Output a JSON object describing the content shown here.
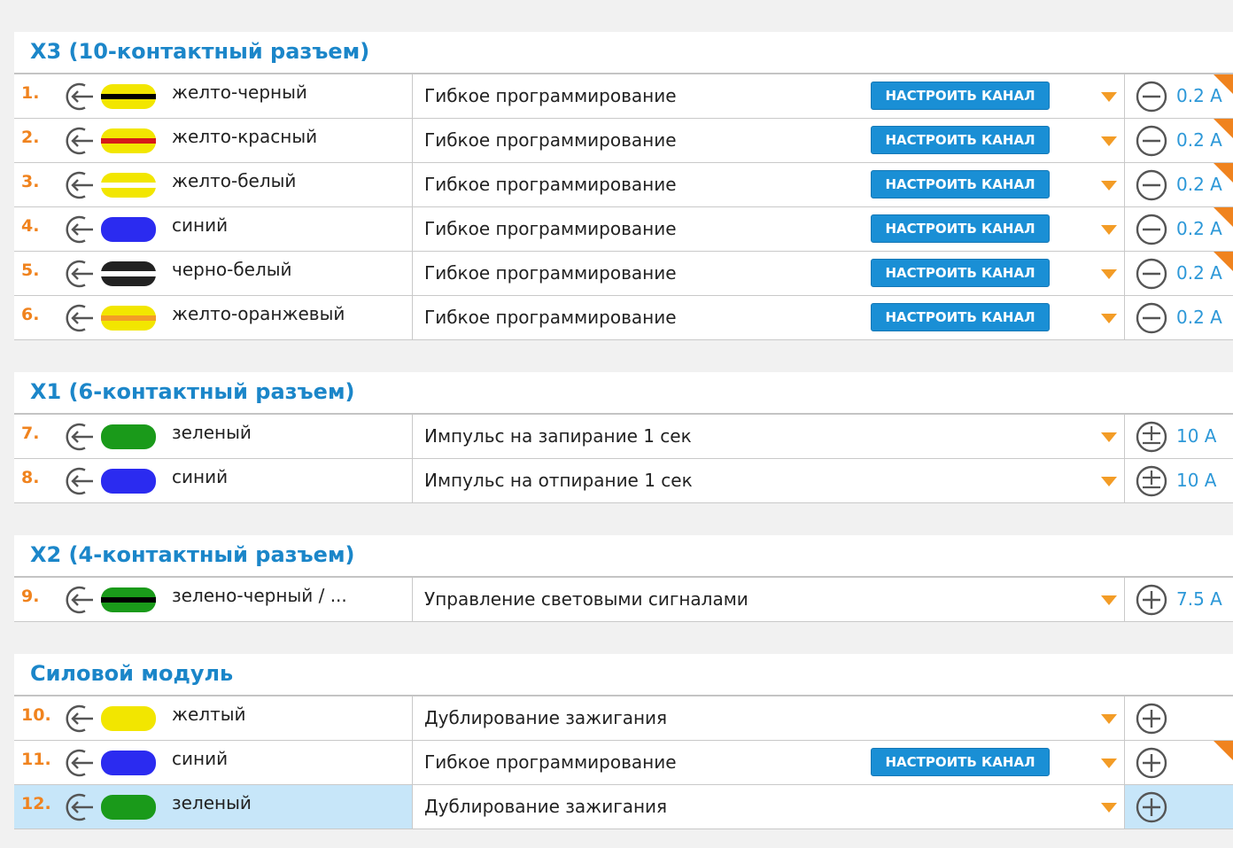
{
  "sections": [
    {
      "title": "X3 (10-контактный разъем)",
      "rows": [
        {
          "num": "1.",
          "wire_colors": [
            "#f2e600",
            "#000000"
          ],
          "color_name": "желто-черный",
          "function": "Гибкое программирование",
          "has_setup": true,
          "setup_label": "НАСТРОИТЬ КАНАЛ",
          "polarity": "minus",
          "current": "0.2 A",
          "flag": true
        },
        {
          "num": "2.",
          "wire_colors": [
            "#f2e600",
            "#d61a1a"
          ],
          "color_name": "желто-красный",
          "function": "Гибкое программирование",
          "has_setup": true,
          "setup_label": "НАСТРОИТЬ КАНАЛ",
          "polarity": "minus",
          "current": "0.2 A",
          "flag": true
        },
        {
          "num": "3.",
          "wire_colors": [
            "#f2e600",
            "#ffffff"
          ],
          "color_name": "желто-белый",
          "function": "Гибкое программирование",
          "has_setup": true,
          "setup_label": "НАСТРОИТЬ КАНАЛ",
          "polarity": "minus",
          "current": "0.2 A",
          "flag": true
        },
        {
          "num": "4.",
          "wire_colors": [
            "#2b2bf0",
            null
          ],
          "color_name": "синий",
          "function": "Гибкое программирование",
          "has_setup": true,
          "setup_label": "НАСТРОИТЬ КАНАЛ",
          "polarity": "minus",
          "current": "0.2 A",
          "flag": true
        },
        {
          "num": "5.",
          "wire_colors": [
            "#222222",
            "#ffffff"
          ],
          "color_name": "черно-белый",
          "function": "Гибкое программирование",
          "has_setup": true,
          "setup_label": "НАСТРОИТЬ КАНАЛ",
          "polarity": "minus",
          "current": "0.2 A",
          "flag": true
        },
        {
          "num": "6.",
          "wire_colors": [
            "#f2e600",
            "#f39c26"
          ],
          "color_name": "желто-оранжевый",
          "function": "Гибкое программирование",
          "has_setup": true,
          "setup_label": "НАСТРОИТЬ КАНАЛ",
          "polarity": "minus",
          "current": "0.2 A",
          "flag": false
        }
      ]
    },
    {
      "title": "X1 (6-контактный разъем)",
      "rows": [
        {
          "num": "7.",
          "wire_colors": [
            "#1a9a1a",
            null
          ],
          "color_name": "зеленый",
          "function": "Импульс на запирание 1 сек",
          "has_setup": false,
          "polarity": "plusminus",
          "current": "10 A",
          "flag": false
        },
        {
          "num": "8.",
          "wire_colors": [
            "#2b2bf0",
            null
          ],
          "color_name": "синий",
          "function": "Импульс на отпирание 1 сек",
          "has_setup": false,
          "polarity": "plusminus",
          "current": "10 A",
          "flag": false
        }
      ]
    },
    {
      "title": "X2 (4-контактный разъем)",
      "rows": [
        {
          "num": "9.",
          "wire_colors": [
            "#1a9a1a",
            "#000000"
          ],
          "color_name": "зелено-черный / ...",
          "function": "Управление световыми сигналами",
          "has_setup": false,
          "polarity": "plus",
          "current": "7.5 A",
          "flag": false
        }
      ]
    },
    {
      "title": "Силовой модуль",
      "rows": [
        {
          "num": "10.",
          "wire_colors": [
            "#f2e600",
            null
          ],
          "color_name": "желтый",
          "function": "Дублирование зажигания",
          "has_setup": false,
          "polarity": "plus",
          "current": "",
          "flag": false
        },
        {
          "num": "11.",
          "wire_colors": [
            "#2b2bf0",
            null
          ],
          "color_name": "синий",
          "function": "Гибкое программирование",
          "has_setup": true,
          "setup_label": "НАСТРОИТЬ КАНАЛ",
          "polarity": "plus",
          "current": "",
          "flag": true
        },
        {
          "num": "12.",
          "wire_colors": [
            "#1a9a1a",
            null
          ],
          "color_name": "зеленый",
          "function": "Дублирование зажигания",
          "has_setup": false,
          "polarity": "plus",
          "current": "",
          "flag": false,
          "highlighted": true
        }
      ]
    }
  ],
  "colors": {
    "accent": "#1b86c9",
    "number": "#f0831e",
    "dropdown_arrow": "#f39c26",
    "button": "#1a8fd5",
    "current_text": "#2d98d8",
    "highlight_row": "#c7e6f9"
  }
}
